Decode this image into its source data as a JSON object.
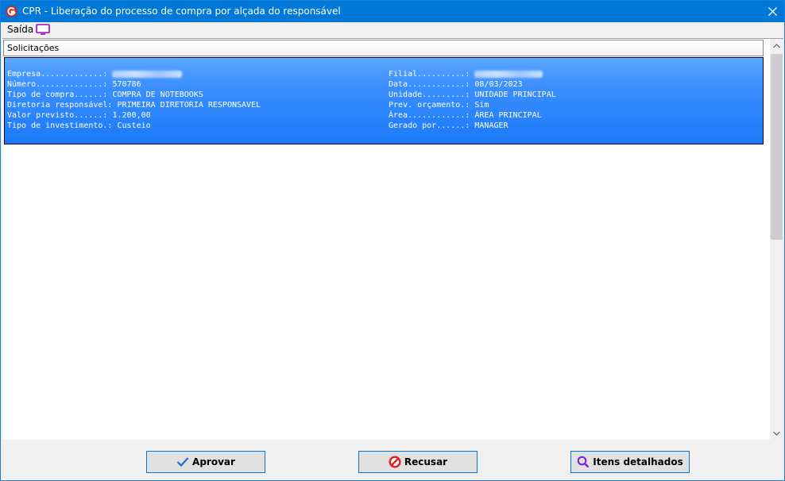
{
  "window": {
    "title": "CPR - Liberação do processo de compra por alçada do responsável"
  },
  "menu": {
    "saida_label": "Saída"
  },
  "list": {
    "column_header": "Solicitações",
    "record": {
      "left": [
        {
          "label": "Empresa.............:",
          "value": ""
        },
        {
          "label": "Número..............:",
          "value": "570786"
        },
        {
          "label": "Tipo de compra......:",
          "value": "COMPRA DE NOTEBOOKS"
        },
        {
          "label": "Diretoria responsável:",
          "value": "PRIMEIRA DIRETORIA RESPONSAVEL"
        },
        {
          "label": "Valor previsto......:",
          "value": "1.200,00"
        },
        {
          "label": "Tipo de investimento.:",
          "value": "Custeio"
        }
      ],
      "right": [
        {
          "label": "Filial..........:",
          "value": ""
        },
        {
          "label": "Data............:",
          "value": "08/03/2023"
        },
        {
          "label": "Unidade.........:",
          "value": "UNIDADE PRINCIPAL"
        },
        {
          "label": "Prev. orçamento.:",
          "value": "Sim"
        },
        {
          "label": "Área............:",
          "value": "ÁREA PRINCIPAL"
        },
        {
          "label": "Gerado por......:",
          "value": "MANAGER"
        }
      ]
    }
  },
  "buttons": {
    "approve": "Aprovar",
    "refuse": "Recusar",
    "details": "Itens detalhados"
  },
  "colors": {
    "titlebar": "#0078d7",
    "selection": "#3d90ff",
    "button_border": "#0078d7"
  },
  "icons": [
    "app-logo-icon",
    "close-icon",
    "monitor-icon",
    "scroll-up-arrow-icon",
    "scroll-down-arrow-icon",
    "checkmark-icon",
    "forbidden-icon",
    "magnifier-icon"
  ]
}
